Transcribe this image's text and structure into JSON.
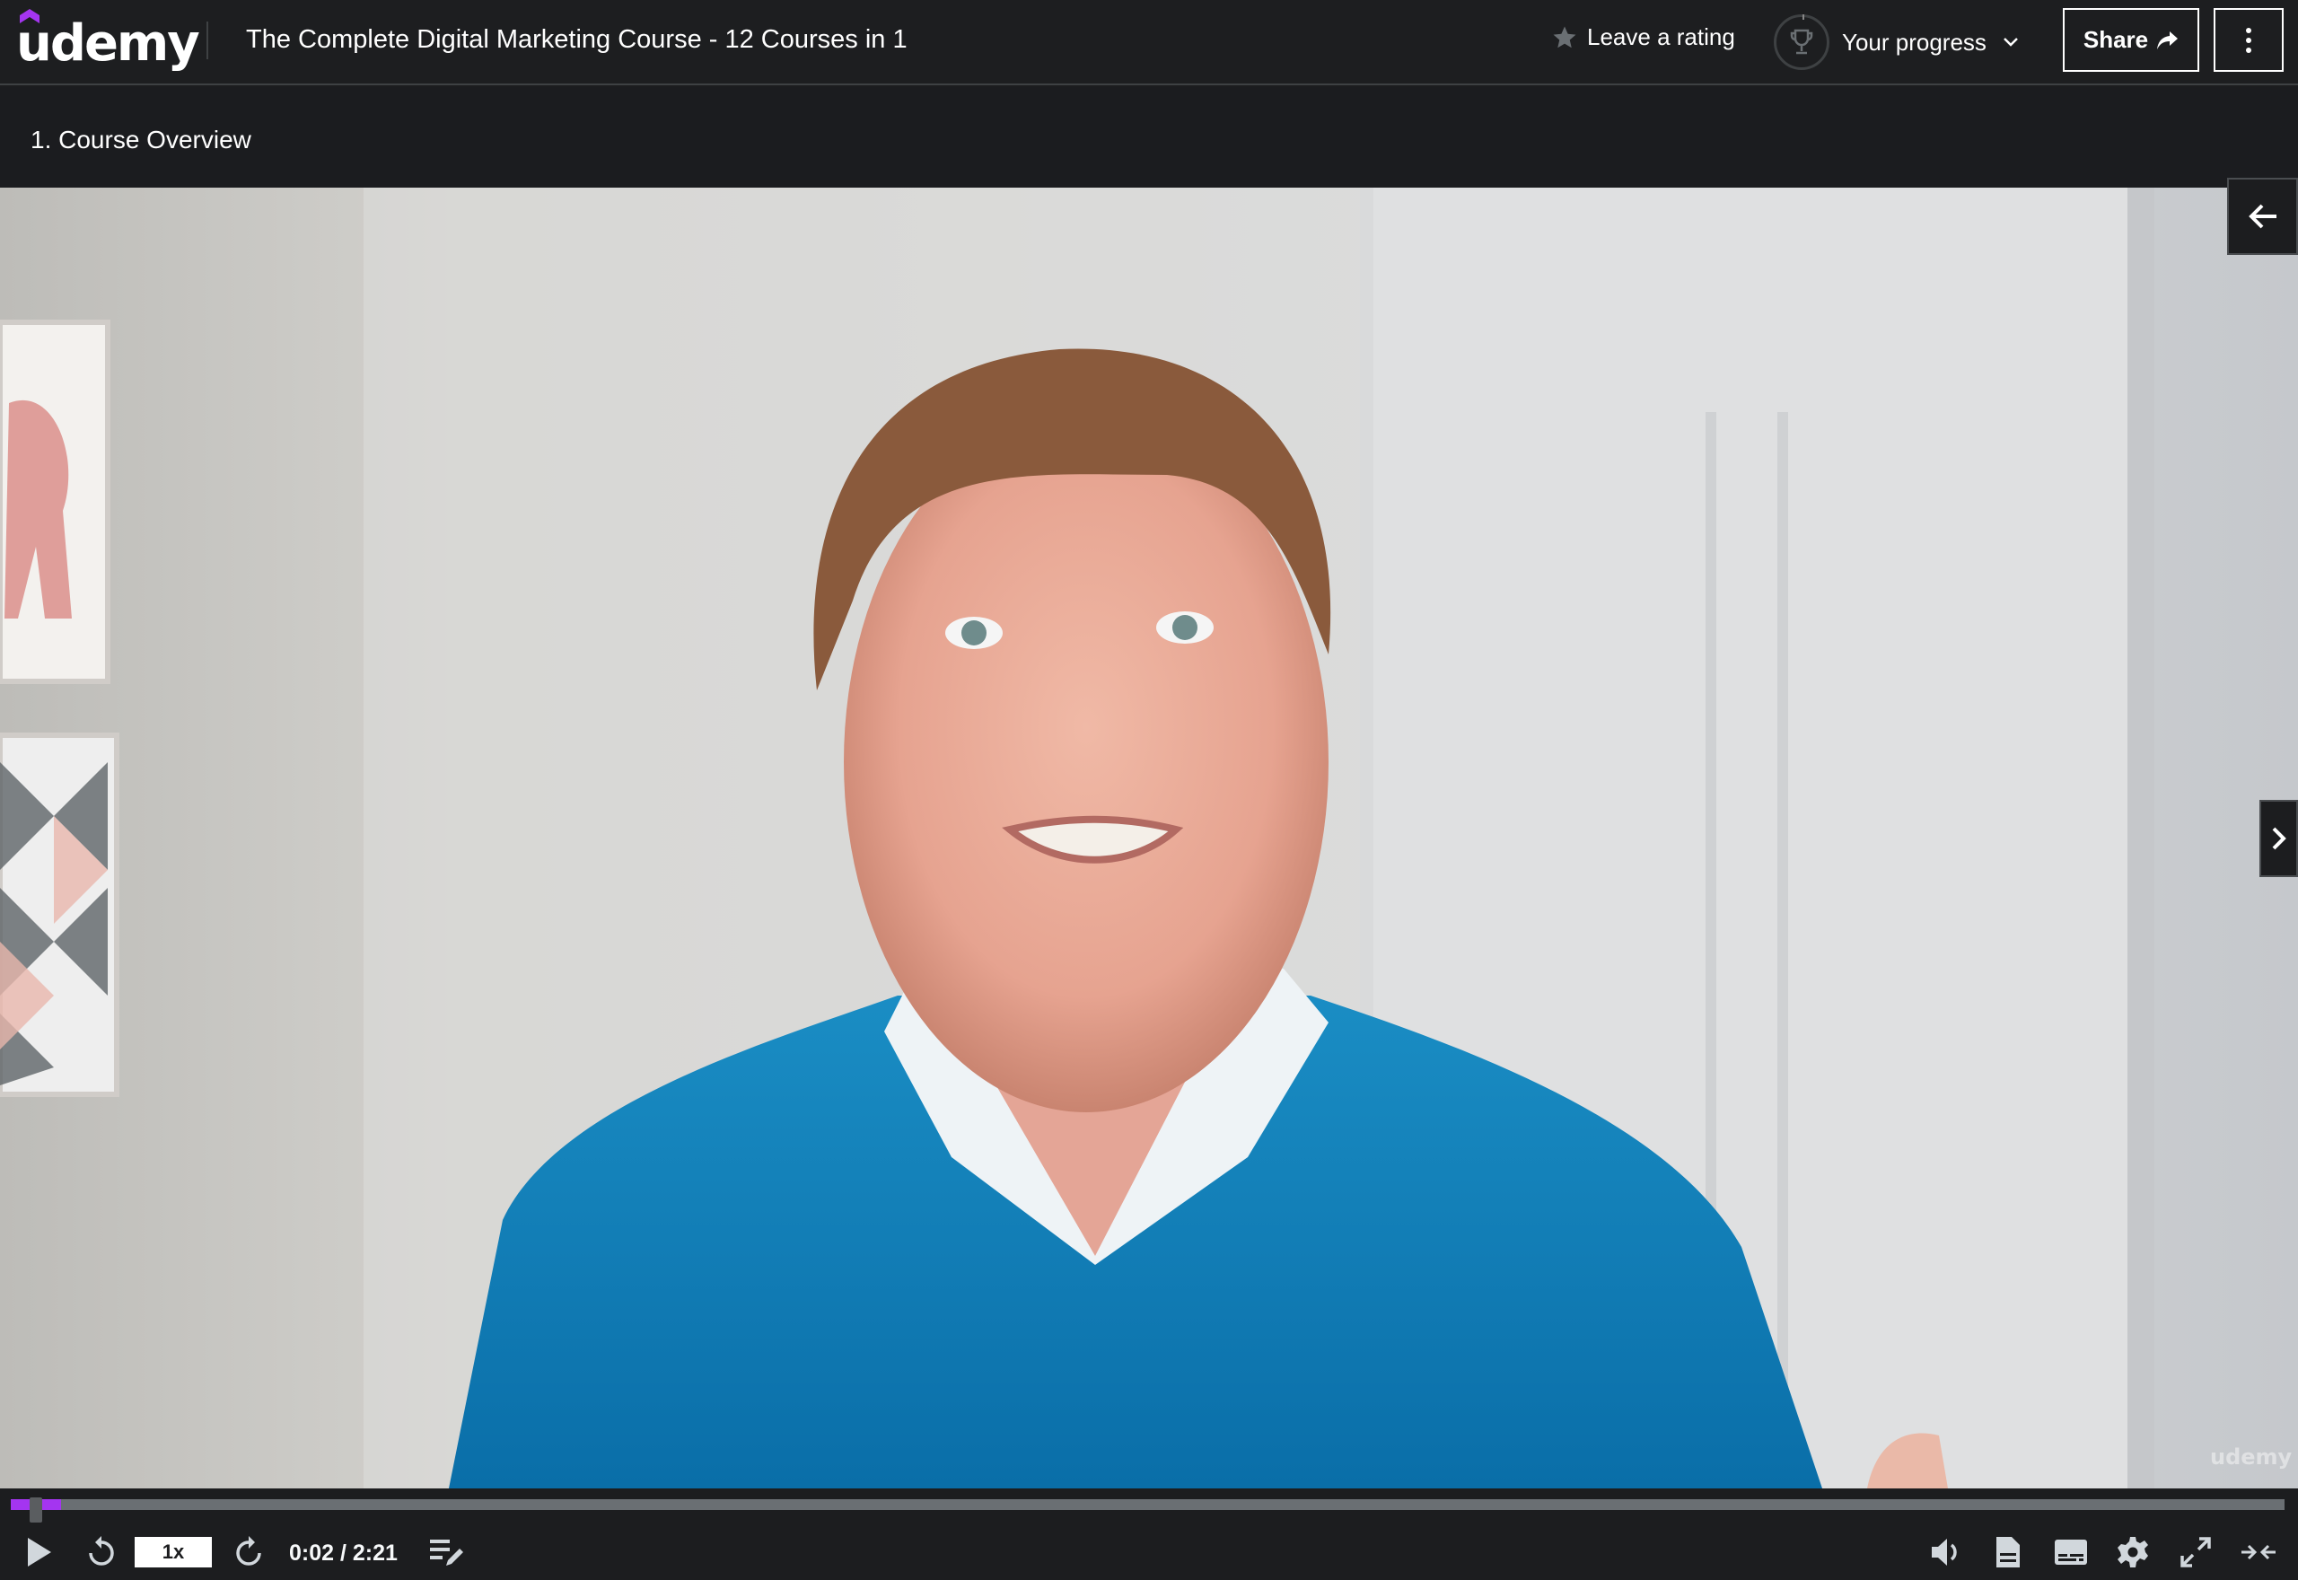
{
  "header": {
    "logo_text": "udemy",
    "course_title": "The Complete Digital Marketing Course - 12 Courses in 1",
    "rating_label": "Leave a rating",
    "progress_label": "Your progress",
    "share_label": "Share",
    "icons": {
      "rating": "star-icon",
      "progress": "trophy-icon",
      "progress_toggle": "chevron-down-icon",
      "share": "share-arrow-icon",
      "more": "more-vertical-icon"
    }
  },
  "lecture": {
    "title": "1. Course Overview"
  },
  "video": {
    "watermark": "udemy",
    "side_buttons": {
      "collapse_sidebar": "arrow-left-icon",
      "next_lecture": "chevron-right-icon"
    }
  },
  "player": {
    "playback_speed": "1x",
    "current_time": "0:02",
    "duration": "2:21",
    "time_display": "0:02 / 2:21",
    "progress_fraction": 0.014,
    "buffered_fraction": 0.022,
    "accent_color": "#a435f0",
    "controls_left": [
      "play-icon",
      "rewind-5-icon",
      "playback-speed",
      "forward-5-icon",
      "time-display",
      "add-note-icon"
    ],
    "controls_right": [
      "volume-icon",
      "transcript-icon",
      "captions-icon",
      "settings-icon",
      "fullscreen-icon",
      "expand-collapse-icon"
    ]
  }
}
